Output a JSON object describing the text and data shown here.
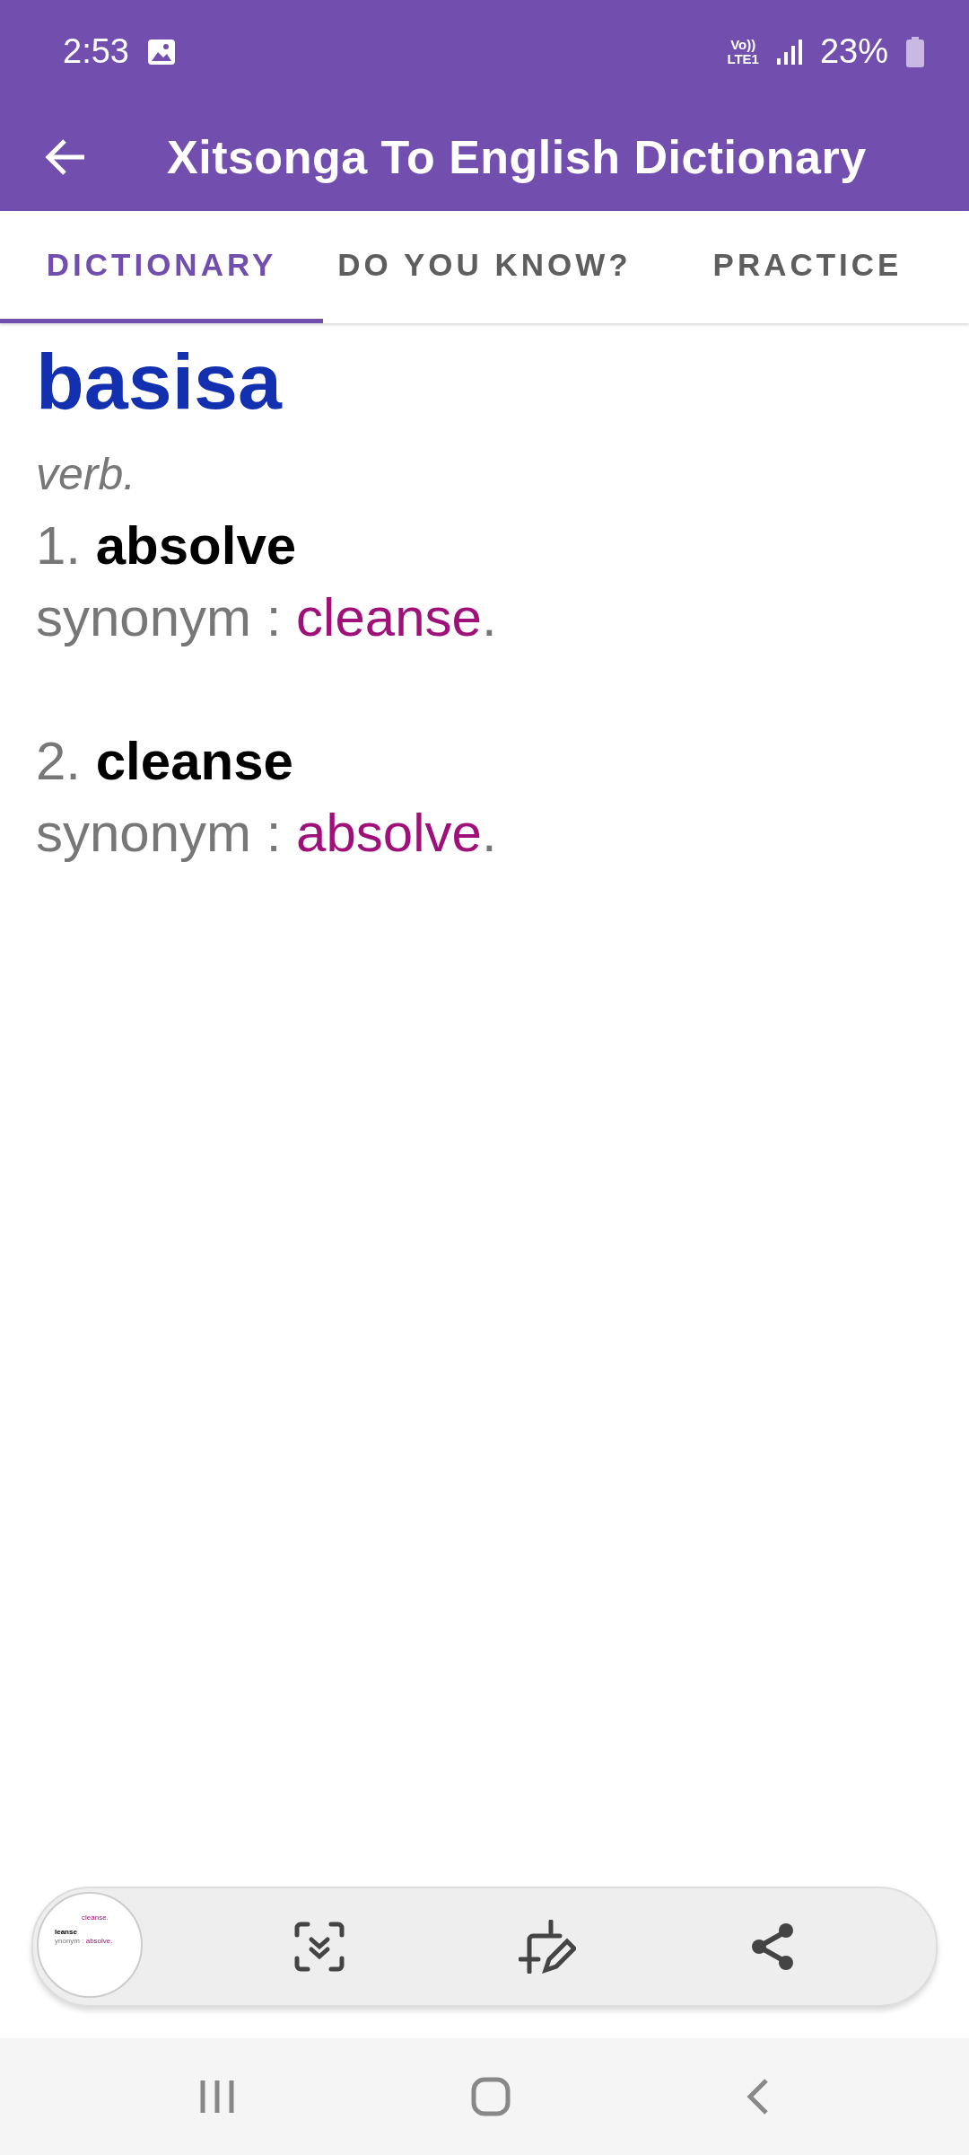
{
  "status_bar": {
    "time": "2:53",
    "network": "Vo))\nLTE1",
    "battery": "23%"
  },
  "app_bar": {
    "title": "Xitsonga To English Dictionary"
  },
  "tabs": [
    {
      "label": "DICTIONARY",
      "selected": true
    },
    {
      "label": "DO YOU KNOW?",
      "selected": false
    },
    {
      "label": "PRACTICE",
      "selected": false
    }
  ],
  "entry": {
    "word": "basisa",
    "part_of_speech": "verb.",
    "senses": [
      {
        "number": "1.",
        "meaning": "absolve",
        "synonym_label": "synonym :",
        "synonym": "cleanse",
        "end": "."
      },
      {
        "number": "2.",
        "meaning": "cleanse",
        "synonym_label": "synonym :",
        "synonym": "absolve",
        "end": "."
      }
    ]
  },
  "screenshot_toolbar": {
    "thumbnail": {
      "top": "cleanse.",
      "heading": "leanse",
      "synonym_label": "ynonym :",
      "synonym": "absolve."
    }
  }
}
